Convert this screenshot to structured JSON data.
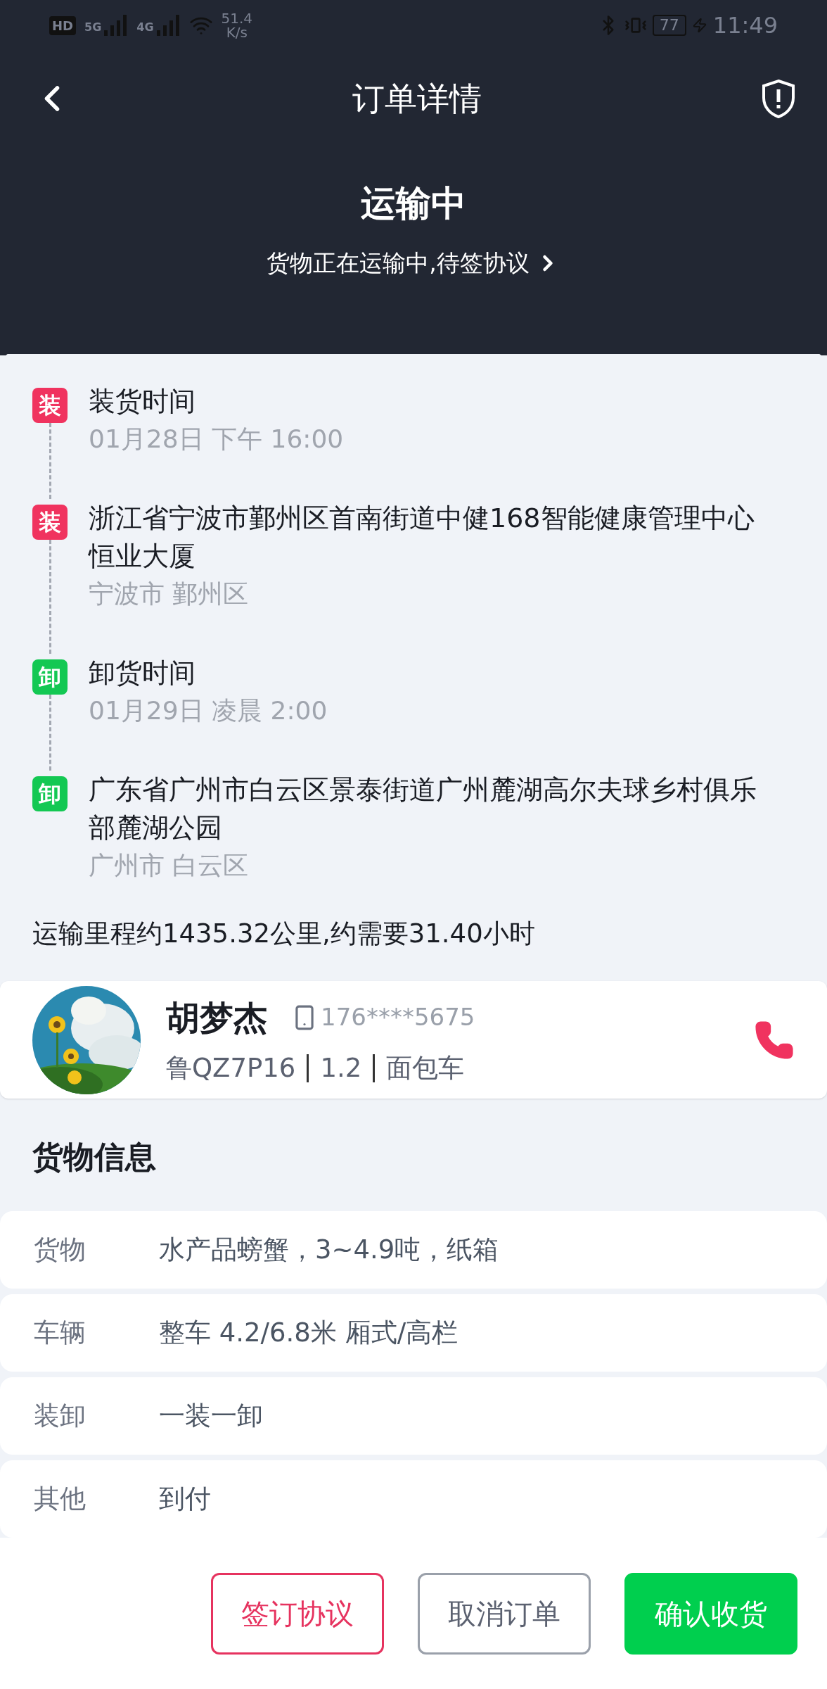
{
  "status_bar": {
    "hd": "HD",
    "networks": [
      "5G",
      "4G"
    ],
    "speed": "51.4",
    "speed_unit": "K/s",
    "battery": "77",
    "time": "11:49"
  },
  "header": {
    "title": "订单详情"
  },
  "status": {
    "title": "运输中",
    "subtitle": "货物正在运输中,待签协议"
  },
  "route": [
    {
      "badge": "装",
      "color": "#f0335f",
      "title": "装货时间",
      "detail": "01月28日 下午 16:00"
    },
    {
      "badge": "装",
      "color": "#f0335f",
      "title": "浙江省宁波市鄞州区首南街道中健168智能健康管理中心恒业大厦",
      "detail": "宁波市 鄞州区"
    },
    {
      "badge": "卸",
      "color": "#13c853",
      "title": "卸货时间",
      "detail": "01月29日 凌晨 2:00"
    },
    {
      "badge": "卸",
      "color": "#13c853",
      "title": "广东省广州市白云区景泰街道广州麓湖高尔夫球乡村俱乐部麓湖公园",
      "detail": "广州市 白云区"
    }
  ],
  "mileage": "运输里程约1435.32公里,约需要31.40小时",
  "driver": {
    "name": "胡梦杰",
    "phone": "176****5675",
    "plate": "鲁QZ7P16",
    "size": "1.2",
    "vehicle_type": "面包车"
  },
  "cargo": {
    "heading": "货物信息",
    "rows": [
      {
        "label": "货物",
        "value": "水产品螃蟹，3~4.9吨，纸箱"
      },
      {
        "label": "车辆",
        "value": "整车 4.2/6.8米 厢式/高栏"
      },
      {
        "label": "装卸",
        "value": "一装一卸"
      },
      {
        "label": "其他",
        "value": "到付"
      }
    ]
  },
  "actions": [
    {
      "label": "签订协议",
      "kind": "outline"
    },
    {
      "label": "取消订单",
      "kind": "plain"
    },
    {
      "label": "确认收货",
      "kind": "primary"
    }
  ]
}
